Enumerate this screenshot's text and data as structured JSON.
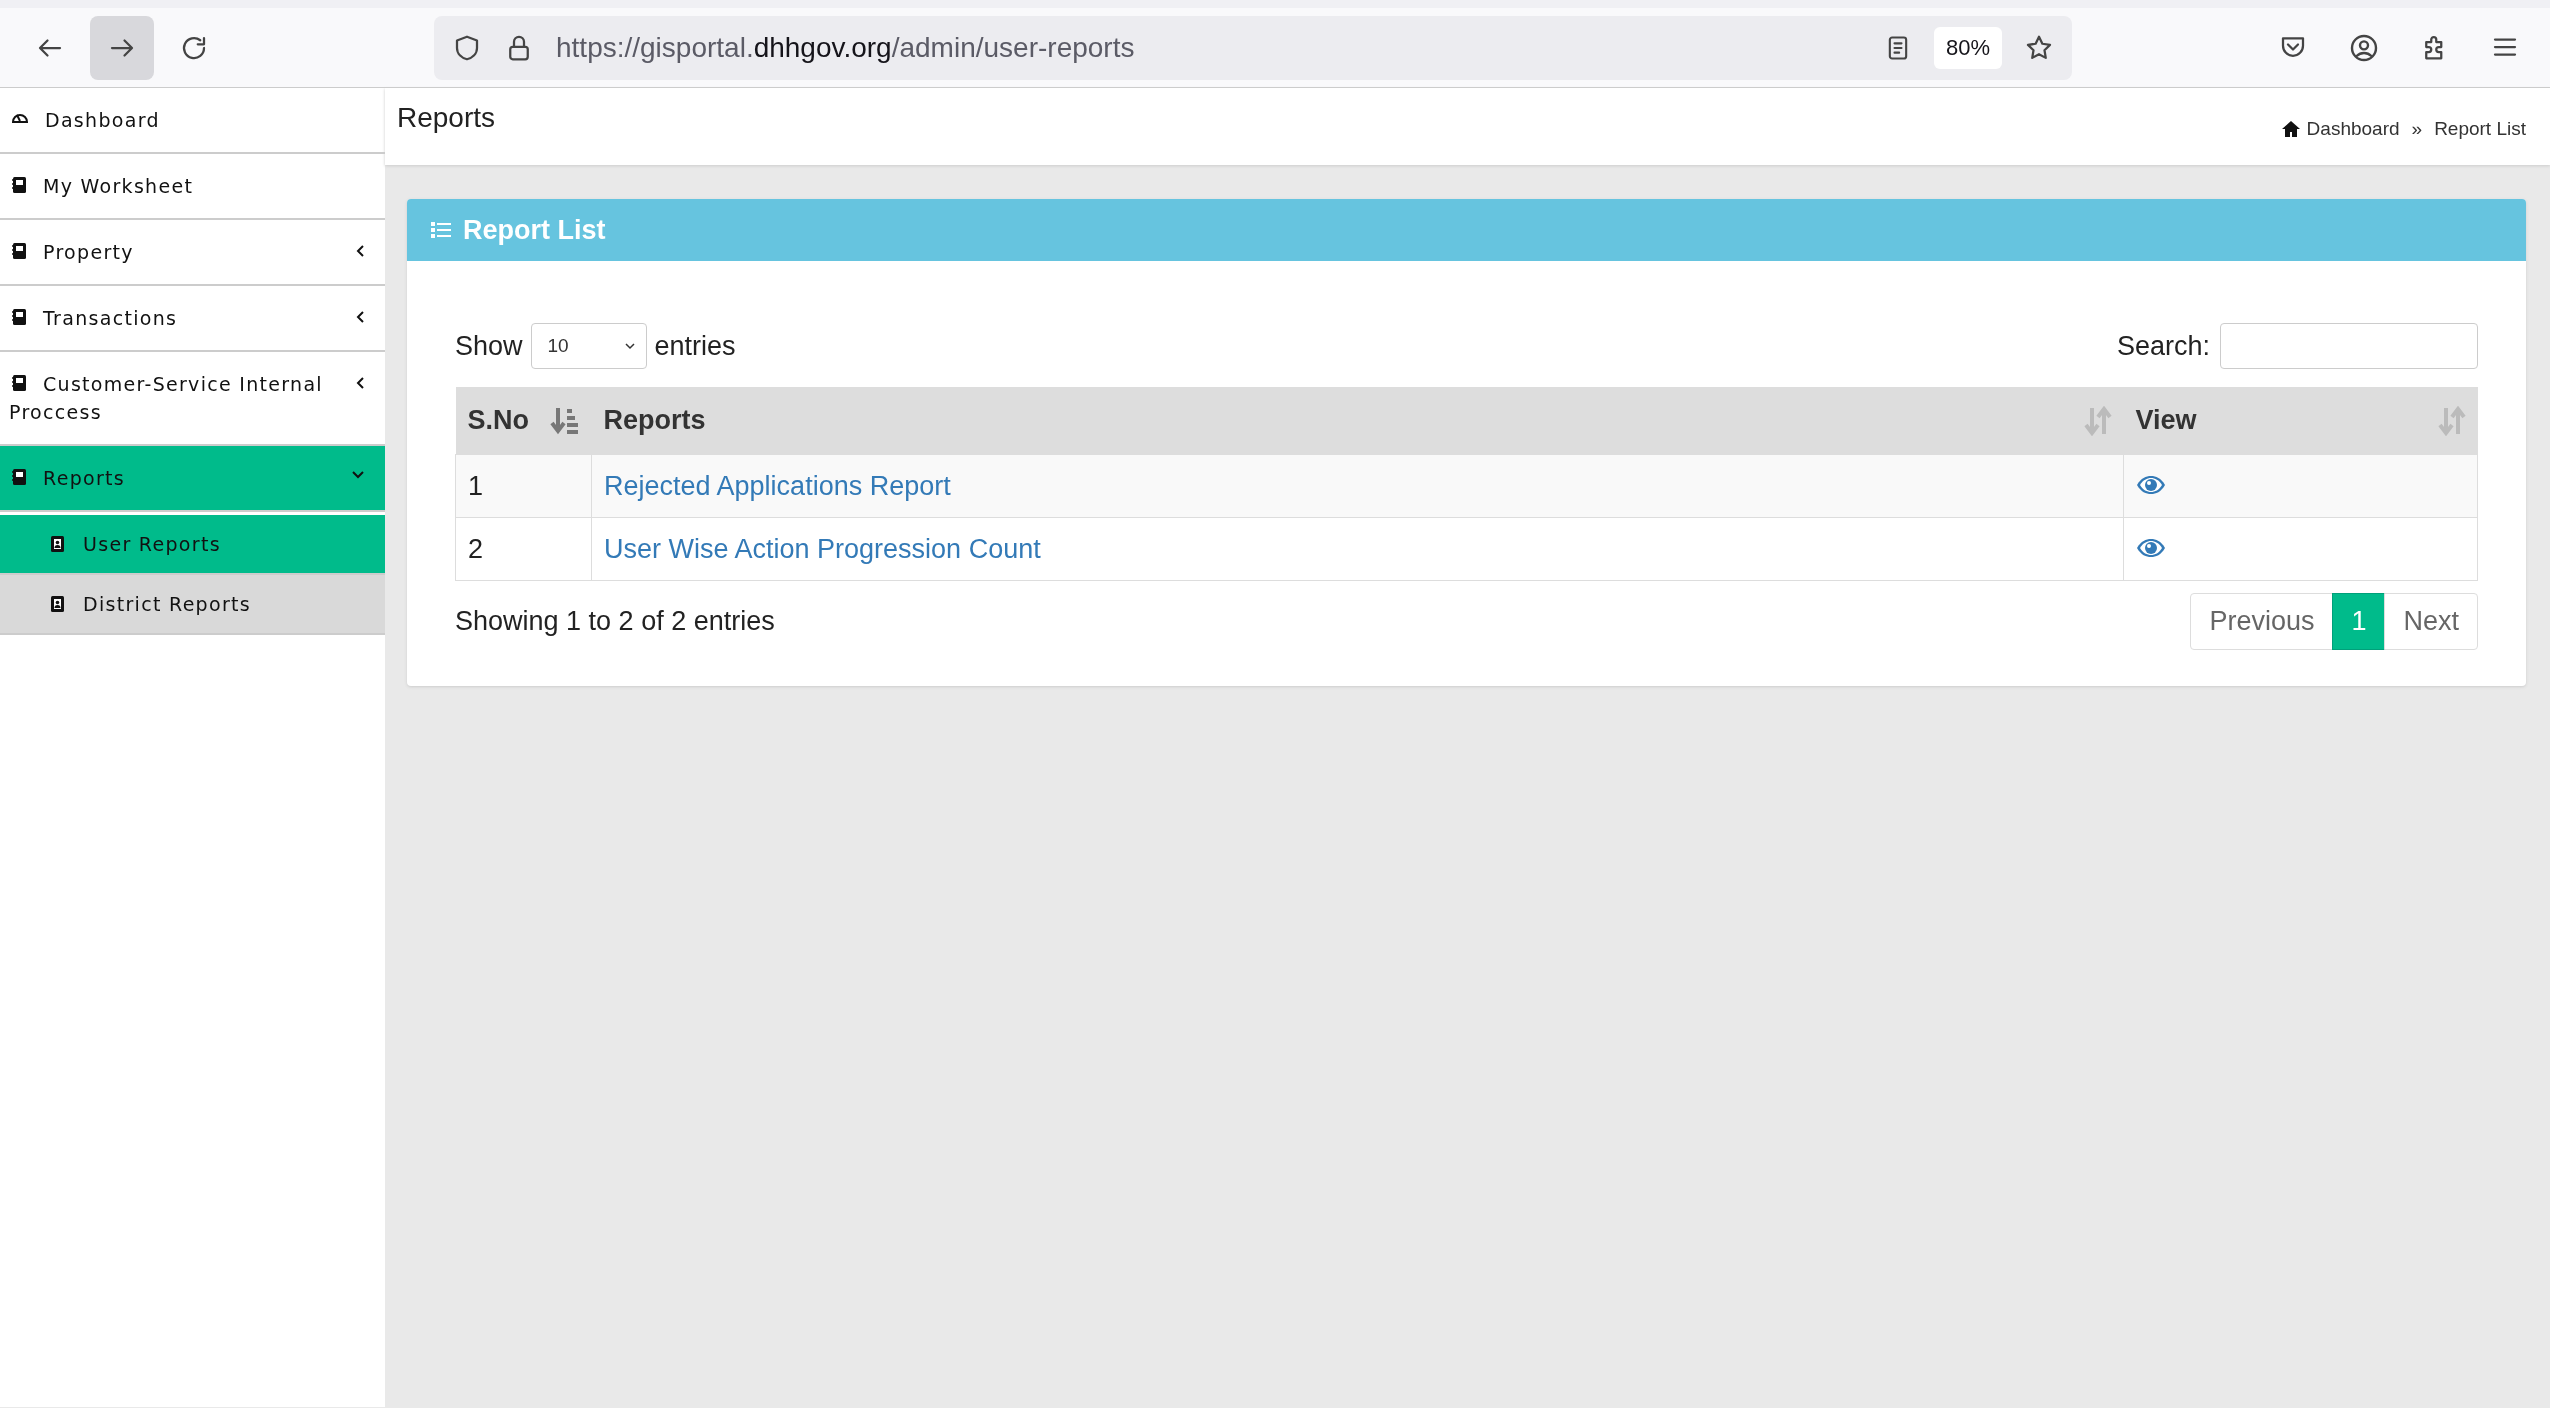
{
  "browser": {
    "url": {
      "prefix": "https://gisportal.",
      "domain": "dhhgov.org",
      "path": "/admin/user-reports"
    },
    "zoom": "80%"
  },
  "sidebar": {
    "items": [
      {
        "label": "Dashboard",
        "kind": "gauge",
        "selected": false
      },
      {
        "label": "My Worksheet",
        "kind": "notebook",
        "selected": false
      },
      {
        "label": "Property",
        "kind": "notebook",
        "selected": false,
        "expanded": false
      },
      {
        "label": "Transactions",
        "kind": "notebook",
        "selected": false,
        "expanded": false
      },
      {
        "label": "Customer-Service Internal Proccess",
        "kind": "notebook",
        "selected": false,
        "expanded": false
      },
      {
        "label": "Reports",
        "kind": "notebook",
        "selected": true,
        "expanded": true,
        "children": [
          {
            "label": "User Reports",
            "selected": true
          },
          {
            "label": "District Reports",
            "selected": false
          }
        ]
      }
    ]
  },
  "page": {
    "title": "Reports",
    "breadcrumb": {
      "separator": "»",
      "items": [
        {
          "label": "Dashboard",
          "kind": "home"
        },
        {
          "label": "Report List",
          "kind": "plain"
        }
      ]
    }
  },
  "card": {
    "title": "Report List",
    "show_label": "Show",
    "page_length": "10",
    "entries_label": "entries",
    "search_label": "Search:",
    "columns": [
      {
        "label": "S.No",
        "sorted": true
      },
      {
        "label": "Reports",
        "sorted": false
      },
      {
        "label": "View",
        "sorted": false
      }
    ],
    "rows": [
      {
        "sno": "1",
        "report": "Rejected Applications Report"
      },
      {
        "sno": "2",
        "report": "User Wise Action Progression Count"
      }
    ],
    "info": "Showing 1 to 2 of 2 entries",
    "pagination": [
      {
        "label": "Previous",
        "selected": false
      },
      {
        "label": "1",
        "selected": true
      },
      {
        "label": "Next",
        "selected": false
      }
    ]
  }
}
